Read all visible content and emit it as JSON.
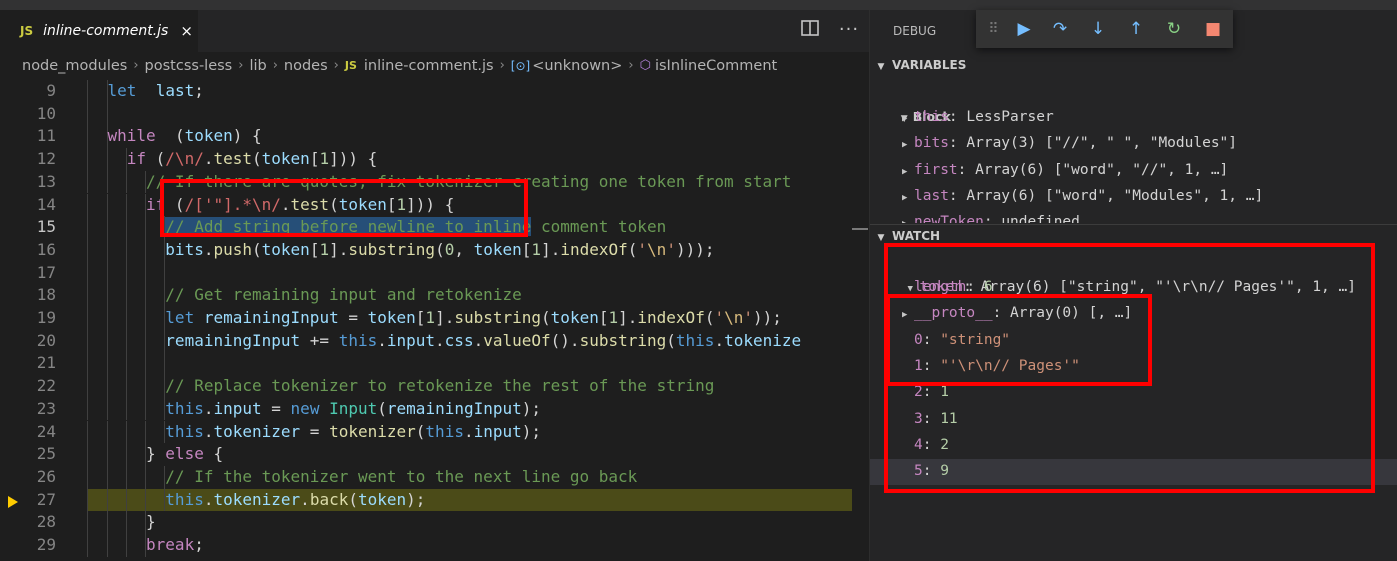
{
  "tab": {
    "icon_label": "JS",
    "title": "inline-comment.js",
    "close_label": "×"
  },
  "editor_actions": {
    "split_icon": "split-editor-icon",
    "more_label": "···"
  },
  "breadcrumb": {
    "items": [
      "node_modules",
      "postcss-less",
      "lib",
      "nodes"
    ],
    "file_badge": "JS",
    "file": "inline-comment.js",
    "symbol_icon": "[⊙]",
    "symbol": "<unknown>",
    "method": "isInlineComment",
    "separator": "›"
  },
  "code": {
    "current_line": 15,
    "debug_line": 27,
    "lines": [
      {
        "n": "9",
        "indent": 3,
        "tokens": [
          [
            "kb",
            "let"
          ],
          [
            "",
            "  "
          ],
          [
            "vr",
            "last"
          ],
          [
            "",
            ";"
          ]
        ]
      },
      {
        "n": "10",
        "indent": 3,
        "tokens": []
      },
      {
        "n": "11",
        "indent": 3,
        "tokens": [
          [
            "kw",
            "while"
          ],
          [
            "",
            "  ("
          ],
          [
            "vr",
            "token"
          ],
          [
            "",
            ") {"
          ]
        ]
      },
      {
        "n": "12",
        "indent": 4,
        "tokens": [
          [
            "kw",
            "if"
          ],
          [
            "",
            " ("
          ],
          [
            "rx",
            "/\\n/"
          ],
          [
            "",
            "."
          ],
          [
            "fn",
            "test"
          ],
          [
            "",
            "("
          ],
          [
            "vr",
            "token"
          ],
          [
            "",
            "["
          ],
          [
            "nm",
            "1"
          ],
          [
            "",
            "])) {"
          ]
        ]
      },
      {
        "n": "13",
        "indent": 5,
        "tokens": [
          [
            "cm",
            "// If there are quotes, fix tokenizer creating one token from start"
          ]
        ]
      },
      {
        "n": "14",
        "indent": 5,
        "tokens": [
          [
            "kw",
            "if"
          ],
          [
            "",
            " ("
          ],
          [
            "rx",
            "/['\"].*\\n/"
          ],
          [
            "",
            "."
          ],
          [
            "fn",
            "test"
          ],
          [
            "",
            "("
          ],
          [
            "vr",
            "token"
          ],
          [
            "",
            "["
          ],
          [
            "nm",
            "1"
          ],
          [
            "",
            "])) {"
          ]
        ]
      },
      {
        "n": "15",
        "indent": 6,
        "tokens": [
          [
            "cm sel",
            "// Add string before newline to inline"
          ],
          [
            "cm",
            " comment token"
          ]
        ]
      },
      {
        "n": "16",
        "indent": 6,
        "tokens": [
          [
            "vr",
            "bits"
          ],
          [
            "",
            "."
          ],
          [
            "fn",
            "push"
          ],
          [
            "",
            "("
          ],
          [
            "vr",
            "token"
          ],
          [
            "",
            "["
          ],
          [
            "nm",
            "1"
          ],
          [
            "",
            "]."
          ],
          [
            "fn",
            "substring"
          ],
          [
            "",
            "("
          ],
          [
            "nm",
            "0"
          ],
          [
            "",
            ", "
          ],
          [
            "vr",
            "token"
          ],
          [
            "",
            "["
          ],
          [
            "nm",
            "1"
          ],
          [
            "",
            "]."
          ],
          [
            "fn",
            "indexOf"
          ],
          [
            "",
            "("
          ],
          [
            "st",
            "'"
          ],
          [
            "es",
            "\\n"
          ],
          [
            "st",
            "'"
          ],
          [
            "",
            ")));"
          ]
        ]
      },
      {
        "n": "17",
        "indent": 6,
        "tokens": []
      },
      {
        "n": "18",
        "indent": 6,
        "tokens": [
          [
            "cm",
            "// Get remaining input and retokenize"
          ]
        ]
      },
      {
        "n": "19",
        "indent": 6,
        "tokens": [
          [
            "kb",
            "let"
          ],
          [
            "",
            " "
          ],
          [
            "vr",
            "remainingInput"
          ],
          [
            "",
            " = "
          ],
          [
            "vr",
            "token"
          ],
          [
            "",
            "["
          ],
          [
            "nm",
            "1"
          ],
          [
            "",
            "]."
          ],
          [
            "fn",
            "substring"
          ],
          [
            "",
            "("
          ],
          [
            "vr",
            "token"
          ],
          [
            "",
            "["
          ],
          [
            "nm",
            "1"
          ],
          [
            "",
            "]."
          ],
          [
            "fn",
            "indexOf"
          ],
          [
            "",
            "("
          ],
          [
            "st",
            "'"
          ],
          [
            "es",
            "\\n"
          ],
          [
            "st",
            "'"
          ],
          [
            "",
            "));"
          ]
        ]
      },
      {
        "n": "20",
        "indent": 6,
        "tokens": [
          [
            "vr",
            "remainingInput"
          ],
          [
            "",
            " += "
          ],
          [
            "kb",
            "this"
          ],
          [
            "",
            "."
          ],
          [
            "vr",
            "input"
          ],
          [
            "",
            "."
          ],
          [
            "vr",
            "css"
          ],
          [
            "",
            "."
          ],
          [
            "fn",
            "valueOf"
          ],
          [
            "",
            "()."
          ],
          [
            "fn",
            "substring"
          ],
          [
            "",
            "("
          ],
          [
            "kb",
            "this"
          ],
          [
            "",
            "."
          ],
          [
            "vr",
            "tokenize"
          ]
        ]
      },
      {
        "n": "21",
        "indent": 6,
        "tokens": []
      },
      {
        "n": "22",
        "indent": 6,
        "tokens": [
          [
            "cm",
            "// Replace tokenizer to retokenize the rest of the string"
          ]
        ]
      },
      {
        "n": "23",
        "indent": 6,
        "tokens": [
          [
            "kb",
            "this"
          ],
          [
            "",
            "."
          ],
          [
            "vr",
            "input"
          ],
          [
            "",
            " = "
          ],
          [
            "kb",
            "new"
          ],
          [
            "",
            " "
          ],
          [
            "cl",
            "Input"
          ],
          [
            "",
            "("
          ],
          [
            "vr",
            "remainingInput"
          ],
          [
            "",
            ");"
          ]
        ]
      },
      {
        "n": "24",
        "indent": 6,
        "tokens": [
          [
            "kb",
            "this"
          ],
          [
            "",
            "."
          ],
          [
            "vr",
            "tokenizer"
          ],
          [
            "",
            " = "
          ],
          [
            "fn",
            "tokenizer"
          ],
          [
            "",
            "("
          ],
          [
            "kb",
            "this"
          ],
          [
            "",
            "."
          ],
          [
            "vr",
            "input"
          ],
          [
            "",
            ");"
          ]
        ]
      },
      {
        "n": "25",
        "indent": 5,
        "tokens": [
          [
            "",
            "} "
          ],
          [
            "kw",
            "else"
          ],
          [
            "",
            " {"
          ]
        ]
      },
      {
        "n": "26",
        "indent": 6,
        "tokens": [
          [
            "cm",
            "// If the tokenizer went to the next line go back"
          ]
        ]
      },
      {
        "n": "27",
        "indent": 6,
        "tokens": [
          [
            "kb",
            "this"
          ],
          [
            "",
            "."
          ],
          [
            "vr",
            "tokenizer"
          ],
          [
            "",
            "."
          ],
          [
            "fn",
            "back"
          ],
          [
            "",
            "("
          ],
          [
            "vr",
            "token"
          ],
          [
            "",
            ");"
          ]
        ]
      },
      {
        "n": "28",
        "indent": 5,
        "tokens": [
          [
            "",
            "}"
          ]
        ]
      },
      {
        "n": "29",
        "indent": 5,
        "tokens": [
          [
            "kw",
            "break"
          ],
          [
            "",
            ";"
          ]
        ]
      }
    ]
  },
  "debug": {
    "title": "DEBUG",
    "toolbar_buttons": [
      {
        "name": "drag-handle",
        "glyph": "⠿",
        "color": "#777777"
      },
      {
        "name": "continue-button",
        "glyph": "▶",
        "color": "#75beff"
      },
      {
        "name": "step-over-button",
        "glyph": "↷",
        "color": "#75beff"
      },
      {
        "name": "step-into-button",
        "glyph": "↓",
        "color": "#75beff"
      },
      {
        "name": "step-out-button",
        "glyph": "↑",
        "color": "#75beff"
      },
      {
        "name": "restart-button",
        "glyph": "↻",
        "color": "#89d185"
      },
      {
        "name": "stop-button",
        "glyph": "■",
        "color": "#f48771"
      }
    ]
  },
  "variables": {
    "header": "VARIABLES",
    "scope": "Block",
    "items": [
      {
        "name": "this",
        "value": "LessParser",
        "type": "plain"
      },
      {
        "name": "bits",
        "value": "Array(3) [\"//\", \" \", \"Modules\"]",
        "type": "plain"
      },
      {
        "name": "first",
        "value": "Array(6) [\"word\", \"//\", 1, …]",
        "type": "plain"
      },
      {
        "name": "last",
        "value": "Array(6) [\"word\", \"Modules\", 1, …]",
        "type": "plain"
      },
      {
        "name": "newToken",
        "value": "undefined",
        "type": "plain"
      }
    ]
  },
  "watch": {
    "header": "WATCH",
    "root": {
      "name": "token",
      "value": "Array(6) [\"string\", \"'\\r\\n// Pages'\", 1, …]"
    },
    "children": [
      {
        "name": "length",
        "value": "6",
        "type": "num",
        "expand": false
      },
      {
        "name": "__proto__",
        "value": "Array(0) [, …]",
        "type": "plain",
        "expand": true
      },
      {
        "name": "0",
        "value": "\"string\"",
        "type": "str",
        "expand": false
      },
      {
        "name": "1",
        "value": "\"'\\r\\n// Pages'\"",
        "type": "str",
        "expand": false
      },
      {
        "name": "2",
        "value": "1",
        "type": "num",
        "expand": false
      },
      {
        "name": "3",
        "value": "11",
        "type": "num",
        "expand": false
      },
      {
        "name": "4",
        "value": "2",
        "type": "num",
        "expand": false
      },
      {
        "name": "5",
        "value": "9",
        "type": "num",
        "expand": false
      }
    ]
  },
  "colors": {
    "highlight_box": "#ff0000",
    "debug_line": "#4b4b18",
    "selection": "#264f78"
  }
}
